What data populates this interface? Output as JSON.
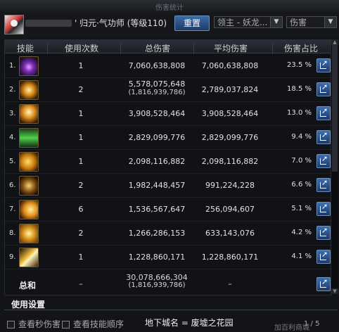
{
  "window": {
    "title": "伤害统计"
  },
  "header": {
    "character_title": "' 归元·气功师 (等级110)",
    "reset_label": "重置",
    "mode_dropdown": "领主 - 妖龙...",
    "type_dropdown": "伤害"
  },
  "table": {
    "columns": [
      "技能",
      "使用次数",
      "总伤害",
      "平均伤害",
      "伤害占比"
    ],
    "rows": [
      {
        "idx": "1.",
        "icon": "purple-burst-skill-icon",
        "uses": "1",
        "total": "7,060,638,808",
        "total_sub": "",
        "avg": "7,060,638,808",
        "pct": "23.5 %"
      },
      {
        "idx": "2.",
        "icon": "golden-spark-skill-icon",
        "uses": "2",
        "total": "5,578,075,648",
        "total_sub": "(1,816,939,786)",
        "avg": "2,789,037,824",
        "pct": "18.5 %"
      },
      {
        "idx": "3.",
        "icon": "fire-figure-skill-icon",
        "uses": "1",
        "total": "3,908,528,464",
        "total_sub": "",
        "avg": "3,908,528,464",
        "pct": "13.0 %"
      },
      {
        "idx": "4.",
        "icon": "green-energy-skill-icon",
        "uses": "1",
        "total": "2,829,099,776",
        "total_sub": "",
        "avg": "2,829,099,776",
        "pct": "9.4 %"
      },
      {
        "idx": "5.",
        "icon": "lion-skill-icon",
        "uses": "1",
        "total": "2,098,116,882",
        "total_sub": "",
        "avg": "2,098,116,882",
        "pct": "7.0 %"
      },
      {
        "idx": "6.",
        "icon": "spiral-ring-skill-icon",
        "uses": "2",
        "total": "1,982,448,457",
        "total_sub": "",
        "avg": "991,224,228",
        "pct": "6.6 %"
      },
      {
        "idx": "7.",
        "icon": "wing-strike-skill-icon",
        "uses": "6",
        "total": "1,536,567,647",
        "total_sub": "",
        "avg": "256,094,607",
        "pct": "5.1 %"
      },
      {
        "idx": "8.",
        "icon": "golden-orb-skill-icon",
        "uses": "2",
        "total": "1,266,286,153",
        "total_sub": "",
        "avg": "633,143,076",
        "pct": "4.2 %"
      },
      {
        "idx": "9.",
        "icon": "light-slash-skill-icon",
        "uses": "1",
        "total": "1,228,860,171",
        "total_sub": "",
        "avg": "1,228,860,171",
        "pct": "4.1 %"
      }
    ],
    "totals": {
      "label": "总和",
      "uses": "–",
      "total": "30,078,666,304",
      "total_sub": "(1,816,939,786)",
      "avg": "–"
    }
  },
  "settings": {
    "title": "使用设置",
    "check_seconds": "查看秒伤害",
    "check_order": "查看技能顺序",
    "dungeon": "地下城名 = 废墟之花园",
    "status": "加百利商城",
    "pager": "1 / 5"
  }
}
